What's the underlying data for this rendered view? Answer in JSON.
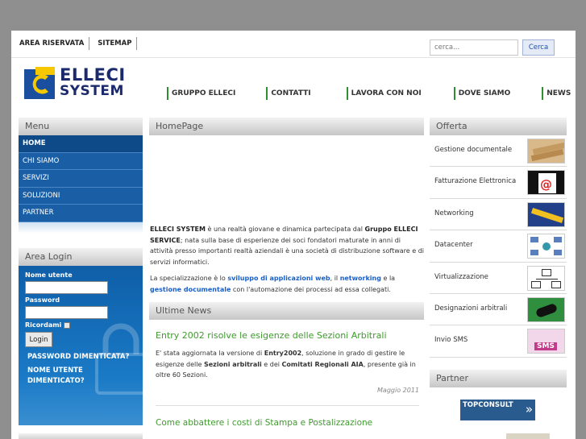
{
  "toplinks": [
    "AREA RISERVATA",
    "SITEMAP"
  ],
  "search": {
    "placeholder": "cerca...",
    "button": "Cerca"
  },
  "logo": {
    "line1": "ELLECI",
    "line2": "SYSTEM"
  },
  "mainnav": [
    "GRUPPO ELLECI",
    "CONTATTI",
    "LAVORA CON NOI",
    "DOVE SIAMO",
    "NEWS"
  ],
  "menu": {
    "title": "Menu",
    "items": [
      "HOME",
      "CHI SIAMO",
      "SERVIZI",
      "SOLUZIONI",
      "PARTNER"
    ]
  },
  "login": {
    "title": "Area Login",
    "username_label": "Nome utente",
    "password_label": "Password",
    "remember_label": "Ricordami",
    "button": "Login",
    "forgot_password": "PASSWORD DIMENTICATA?",
    "forgot_username_1": "NOME UTENTE",
    "forgot_username_2": "DIMENTICATO?"
  },
  "home": {
    "title": "HomePage",
    "p1_b1": "ELLECI SYSTEM",
    "p1_t1": " è una realtà giovane e dinamica partecipata dal ",
    "p1_b2": "Gruppo ELLECI SERVICE",
    "p1_t2": "; nata sulla base di esperienze dei soci fondatori maturate in anni di attività presso importanti realtà aziendali è una società di distribuzione software e di servizi informatici.",
    "p2_t1": "La specializzazione è lo ",
    "p2_l1": "sviluppo di applicazioni web",
    "p2_t2": ", il ",
    "p2_l2": "networking",
    "p2_t3": " e la ",
    "p2_l3": "gestione documentale",
    "p2_t4": " con l'automazione dei processi ad essa collegati."
  },
  "news": {
    "title": "Ultime News",
    "item_title": "Entry 2002 risolve le esigenze delle Sezioni Arbitrali",
    "t1": "E' stata aggiornata la versione di ",
    "b1": "Entry2002",
    "t2": ", soluzione in grado di gestire le esigenze delle ",
    "b2": "Sezioni arbitrali",
    "t3": " e dei ",
    "b3": "Comitati Regionali AIA",
    "t4": ", presente già in oltre 60 Sezioni.",
    "date": "Maggio 2011",
    "next_title": "Come abbattere i costi di Stampa e Postalizzazione"
  },
  "offerta": {
    "title": "Offerta",
    "items": [
      "Gestione documentale",
      "Fatturazione Elettronica",
      "Networking",
      "Datacenter",
      "Virtualizzazione",
      "Designazioni arbitrali",
      "Invio SMS"
    ]
  },
  "partner": {
    "title": "Partner",
    "logo_text": "TOPCONSULT"
  },
  "colors": {
    "menu_blue": "#1a5fa6",
    "nav_green": "#2f8f2f",
    "news_green": "#3f9a2e",
    "link_blue": "#1a5fc7"
  }
}
